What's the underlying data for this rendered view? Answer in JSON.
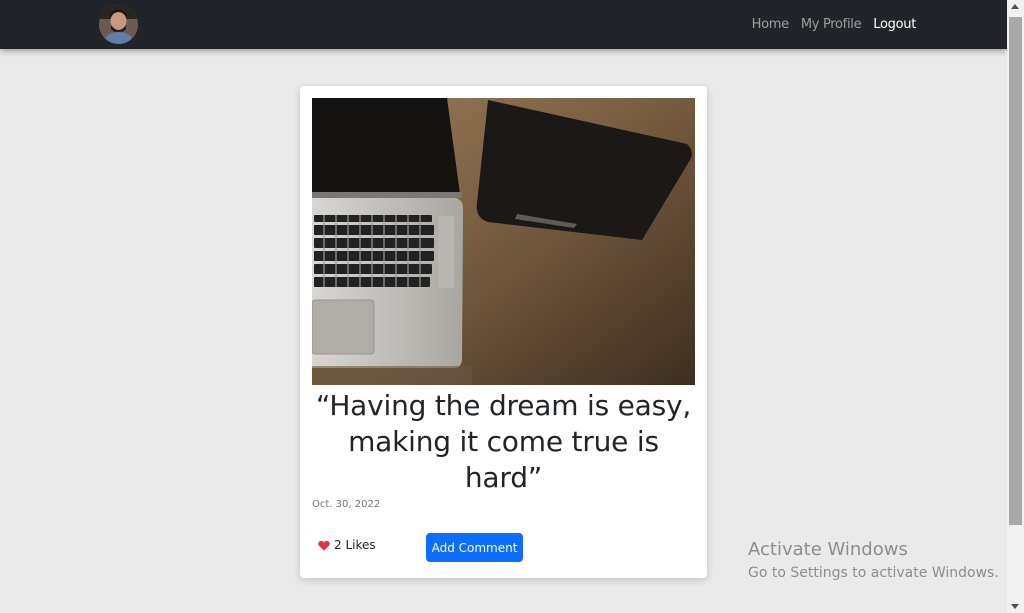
{
  "navbar": {
    "links": [
      {
        "label": "Home"
      },
      {
        "label": "My Profile"
      },
      {
        "label": "Logout"
      }
    ]
  },
  "post": {
    "title": "“Having the dream is easy, making it come true is hard”",
    "date": "Oct. 30, 2022",
    "likes_label": "2 Likes",
    "comment_button_label": "Add Comment"
  },
  "watermark": {
    "title": "Activate Windows",
    "subtitle": "Go to Settings to activate Windows."
  },
  "colors": {
    "navbar_bg": "#212529",
    "page_bg": "#ebeaea",
    "primary_button": "#0d6efd",
    "heart": "#dc3545"
  },
  "icons": [
    "user-avatar",
    "heart-icon"
  ]
}
